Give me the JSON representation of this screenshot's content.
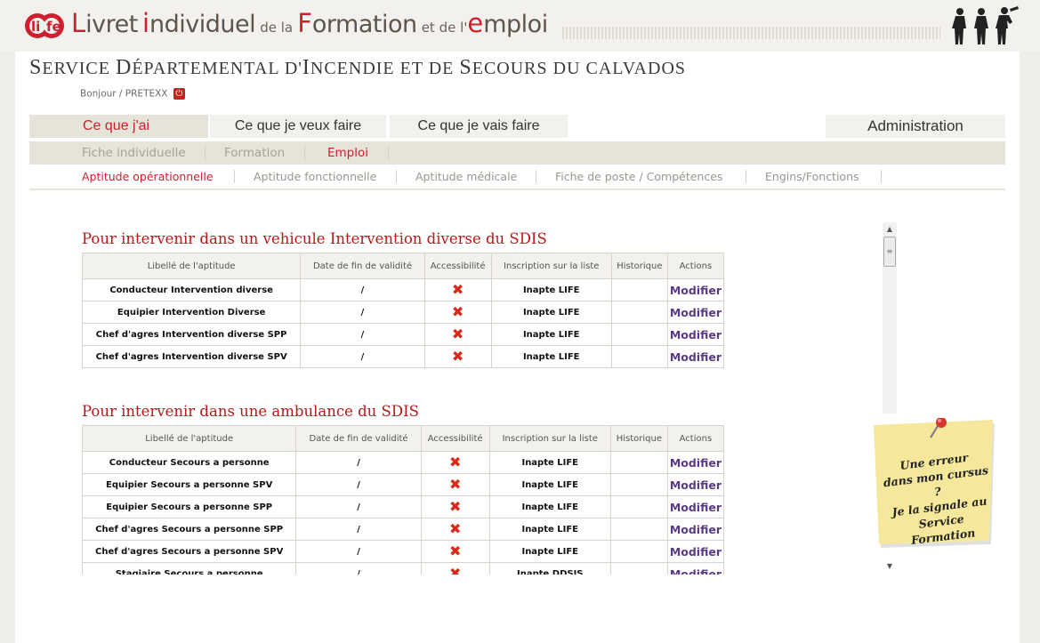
{
  "banner": {
    "w1a": "L",
    "w1b": "ivret",
    "w2a": "i",
    "w2b": "ndividuel",
    "w3": "de la",
    "w4a": "F",
    "w4b": "ormation",
    "w5": "et de l'",
    "w6a": "e",
    "w6b": "mploi"
  },
  "header": {
    "org_parts": [
      "S",
      "ERVICE ",
      "D",
      "ÉPARTEMENTAL D'",
      "I",
      "NCENDIE ET DE ",
      "S",
      "ECOURS DU CALVADOS"
    ],
    "greeting": "Bonjour / PRETEXX",
    "power_symbol": "⏻"
  },
  "tabs": [
    {
      "label": "Ce que j'ai",
      "active": true
    },
    {
      "label": "Ce que je veux faire",
      "active": false
    },
    {
      "label": "Ce que je vais faire",
      "active": false
    },
    {
      "label": "Administration",
      "active": false
    }
  ],
  "subnav": [
    {
      "label": "Fiche individuelle",
      "active": false
    },
    {
      "label": "Formation",
      "active": false
    },
    {
      "label": "Emploi",
      "active": true
    }
  ],
  "aptnav": [
    {
      "label": "Aptitude opérationnelle",
      "active": true
    },
    {
      "label": "Aptitude fonctionnelle",
      "active": false
    },
    {
      "label": "Aptitude médicale",
      "active": false
    },
    {
      "label": "Fiche de poste / Compétences",
      "active": false
    },
    {
      "label": "Engins/Fonctions",
      "active": false
    }
  ],
  "columns": [
    "Libellé de l'aptitude",
    "Date de fin de validité",
    "Accessibilité",
    "Inscription sur la liste",
    "Historique",
    "Actions"
  ],
  "sections": [
    {
      "title": "Pour intervenir dans un vehicule Intervention diverse du SDIS",
      "rows": [
        {
          "label": "Conducteur Intervention diverse",
          "date": "/",
          "status": "Inapte LIFE",
          "history": "",
          "action": "Modifier"
        },
        {
          "label": "Equipier Intervention Diverse",
          "date": "/",
          "status": "Inapte LIFE",
          "history": "",
          "action": "Modifier"
        },
        {
          "label": "Chef d'agres Intervention diverse SPP",
          "date": "/",
          "status": "Inapte LIFE",
          "history": "",
          "action": "Modifier"
        },
        {
          "label": "Chef d'agres Intervention diverse SPV",
          "date": "/",
          "status": "Inapte LIFE",
          "history": "",
          "action": "Modifier"
        }
      ]
    },
    {
      "title": "Pour intervenir dans une ambulance du SDIS",
      "rows": [
        {
          "label": "Conducteur Secours a personne",
          "date": "/",
          "status": "Inapte LIFE",
          "history": "",
          "action": "Modifier"
        },
        {
          "label": "Equipier Secours a personne SPV",
          "date": "/",
          "status": "Inapte LIFE",
          "history": "",
          "action": "Modifier"
        },
        {
          "label": "Equipier Secours a personne SPP",
          "date": "/",
          "status": "Inapte LIFE",
          "history": "",
          "action": "Modifier"
        },
        {
          "label": "Chef d'agres Secours a personne SPP",
          "date": "/",
          "status": "Inapte LIFE",
          "history": "",
          "action": "Modifier"
        },
        {
          "label": "Chef d'agres Secours a personne SPV",
          "date": "/",
          "status": "Inapte LIFE",
          "history": "",
          "action": "Modifier"
        },
        {
          "label": "Stagiaire Secours a personne",
          "date": "/",
          "status": "Inapte DDSIS",
          "history": "",
          "action": "Modifier"
        }
      ]
    }
  ],
  "accessibility_icon": "red-x-icon",
  "accessibility_glyph": "✖",
  "note": {
    "line1": "Une erreur",
    "line2": "dans mon cursus ?",
    "line3": "Je la signale au",
    "line4": "Service Formation"
  },
  "scrollbar": {
    "up": "▲",
    "down": "▼",
    "grip": "≡"
  },
  "colors": {
    "brand_red": "#cf1f2e",
    "section_title": "#b81818",
    "action_link": "#5b3a85",
    "tab_bg": "#e6e3d8",
    "note_yellow": "#f5e79b"
  }
}
